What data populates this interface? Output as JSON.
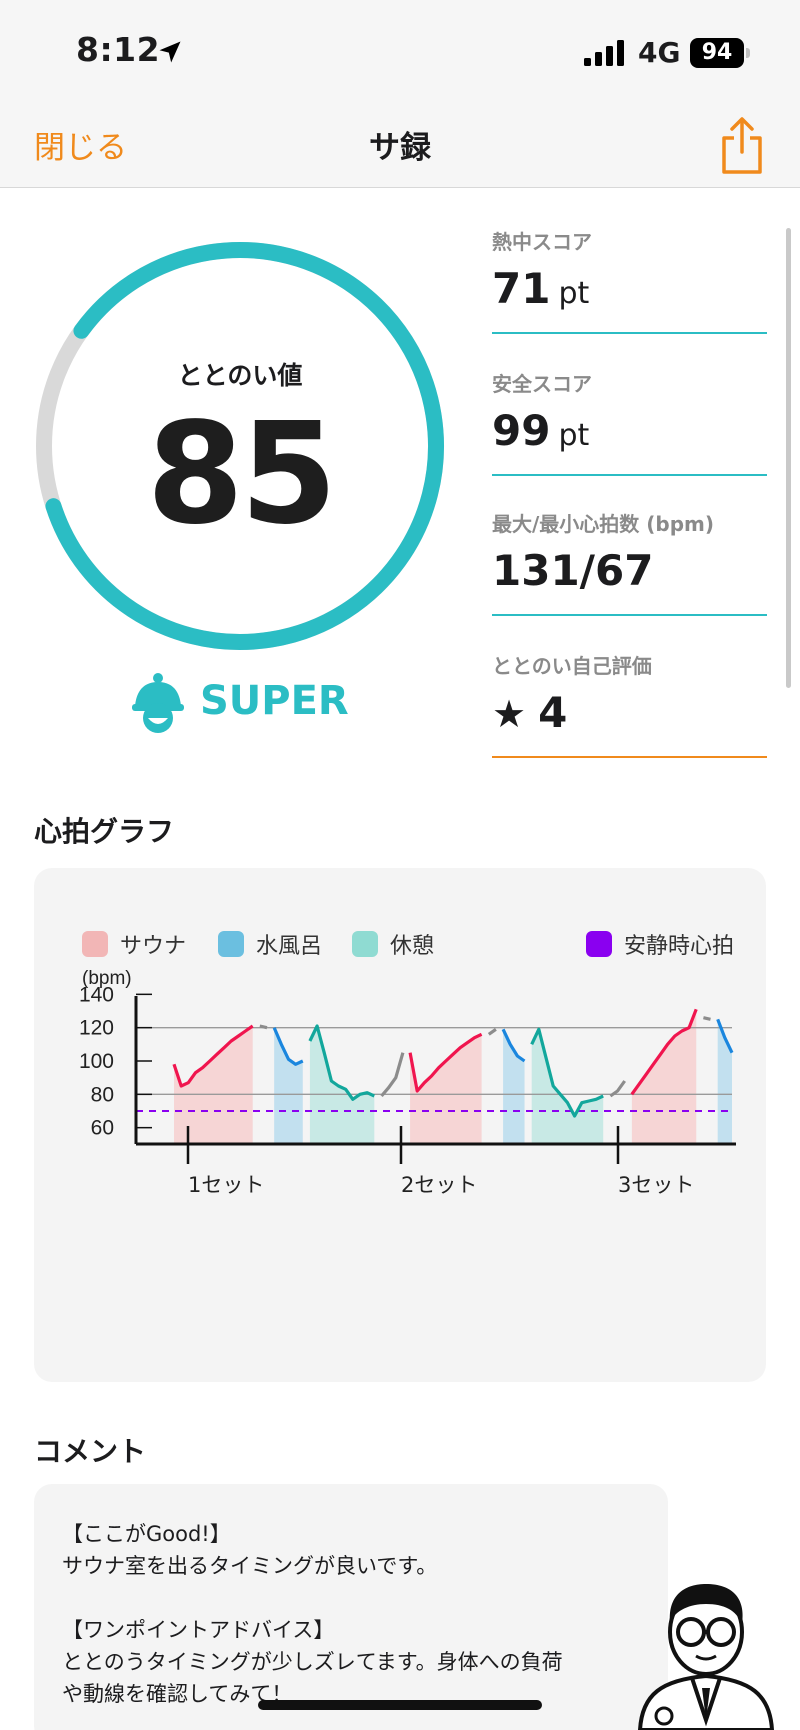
{
  "status_bar": {
    "time": "8:12",
    "network": "4G",
    "battery": "94"
  },
  "nav": {
    "close_label": "閉じる",
    "title": "サ録"
  },
  "score": {
    "label": "ととのい値",
    "value": "85",
    "progress": 0.85,
    "grade": "SUPER"
  },
  "stats": [
    {
      "label": "熱中スコア",
      "value": "71",
      "unit": "pt"
    },
    {
      "label": "安全スコア",
      "value": "99",
      "unit": "pt"
    },
    {
      "label": "最大/最小心拍数 (bpm)",
      "value": "131/67",
      "unit": ""
    },
    {
      "label": "ととのい自己評価",
      "value": "4",
      "unit": ""
    }
  ],
  "graph": {
    "title": "心拍グラフ",
    "legend": [
      {
        "label": "サウナ",
        "color": "#f2b6b6"
      },
      {
        "label": "水風呂",
        "color": "#6bbfe0"
      },
      {
        "label": "休憩",
        "color": "#8fdbd2"
      },
      {
        "label": "安静時心拍",
        "color": "#8a00f0"
      }
    ]
  },
  "chart_data": {
    "type": "line",
    "ylabel": "(bpm)",
    "ylim": [
      55,
      145
    ],
    "yticks": [
      "140",
      "120",
      "100",
      "80",
      "60"
    ],
    "categories": [
      "1セット",
      "2セット",
      "3セット"
    ],
    "resting_hr": 70,
    "reference_lines": [
      120,
      80
    ],
    "segments": [
      {
        "phase": "sauna",
        "values": [
          98,
          85,
          87,
          93,
          96,
          100,
          104,
          108,
          112,
          115,
          118,
          121
        ]
      },
      {
        "phase": "transition",
        "values": [
          121,
          120
        ]
      },
      {
        "phase": "cold",
        "values": [
          120,
          110,
          101,
          98,
          100
        ]
      },
      {
        "phase": "rest",
        "values": [
          112,
          121,
          105,
          88,
          85,
          83,
          77,
          80,
          81,
          79
        ]
      },
      {
        "phase": "transition",
        "values": [
          79,
          84,
          90,
          105
        ]
      },
      {
        "phase": "sauna",
        "values": [
          105,
          82,
          87,
          91,
          96,
          100,
          104,
          108,
          111,
          114,
          116
        ]
      },
      {
        "phase": "transition",
        "values": [
          116,
          119
        ]
      },
      {
        "phase": "cold",
        "values": [
          119,
          110,
          103,
          100
        ]
      },
      {
        "phase": "rest",
        "values": [
          110,
          119,
          102,
          85,
          80,
          75,
          67,
          75,
          76,
          77,
          79
        ]
      },
      {
        "phase": "transition",
        "values": [
          79,
          82,
          88
        ]
      },
      {
        "phase": "sauna",
        "values": [
          80,
          86,
          92,
          98,
          104,
          110,
          115,
          118,
          120,
          131
        ]
      },
      {
        "phase": "transition",
        "values": [
          126,
          125
        ]
      },
      {
        "phase": "cold",
        "values": [
          125,
          114,
          105
        ]
      }
    ]
  },
  "comment": {
    "title": "コメント",
    "lines": [
      "【ここがGood!】",
      "サウナ室を出るタイミングが良いです。",
      "",
      "【ワンポイントアドバイス】",
      "ととのうタイミングが少しズレてます。身体への負荷",
      "や動線を確認してみて！"
    ]
  },
  "colors": {
    "accent": "#2bbdc4",
    "orange": "#f08a1c",
    "sauna": "#f0154e",
    "cold": "#1a86de",
    "rest": "#12a79c",
    "transition": "#8c8c8c"
  },
  "icons": {
    "location": "location-arrow-icon",
    "share": "share-icon",
    "mascot": "sauna-hat-mascot-icon",
    "star": "star-icon",
    "doctor": "doctor-icon"
  }
}
